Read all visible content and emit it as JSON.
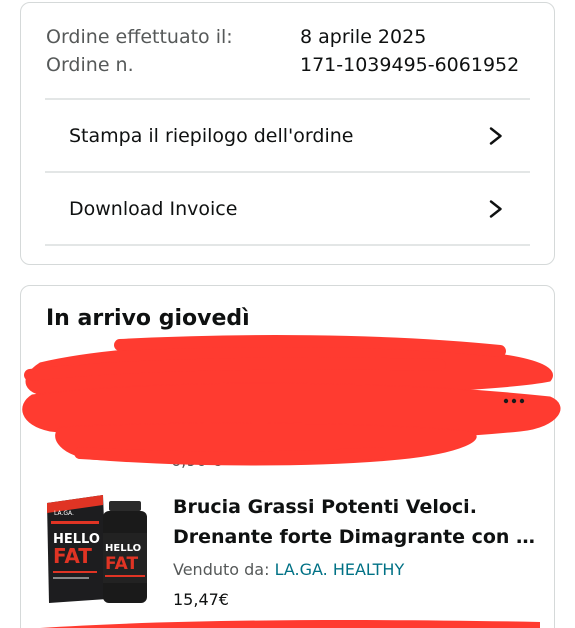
{
  "order_info": {
    "date_label": "Ordine effettuato il:",
    "date_value": "8 aprile 2025",
    "number_label": "Ordine n.",
    "number_value": "171-1039495-6061952"
  },
  "actions": {
    "print_summary": "Stampa il riepilogo dell'ordine",
    "download_invoice": "Download Invoice"
  },
  "delivery": {
    "title": "In arrivo giovedì",
    "hidden_item": {
      "price_fragment": "6,90 €",
      "redacted": true
    },
    "item": {
      "title_line1": "Brucia Grassi Potenti Veloci.",
      "title_line2": "Drenante forte Dimagrante con G…",
      "seller_label": "Venduto da:",
      "seller_name": "LA.GA. HEALTHY",
      "price": "15,47€",
      "product_brand": "LA.GA.",
      "product_name_1": "HELLO",
      "product_name_2": "FAT"
    }
  },
  "colors": {
    "redaction": "#ff3b30",
    "link": "#007185",
    "text": "#0f1111",
    "secondary": "#565959",
    "border": "#d5d9d9"
  },
  "icons": {
    "chevron": "chevron-right-icon"
  }
}
